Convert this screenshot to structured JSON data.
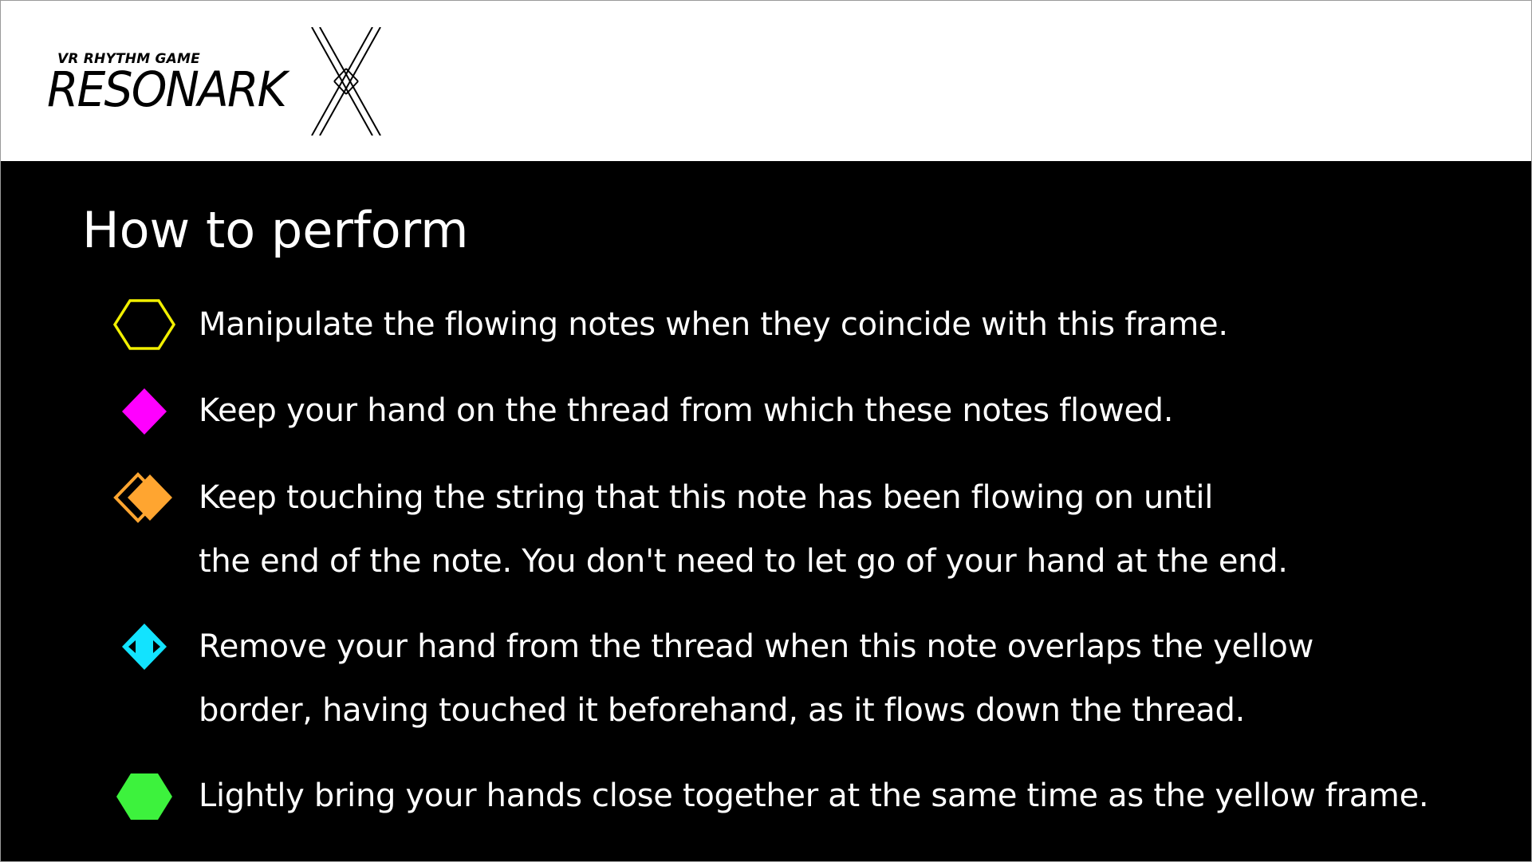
{
  "brand": {
    "subtitle": "VR RHYTHM GAME",
    "name": "RESONARK",
    "mark_icon": "crossed-lines-x-icon"
  },
  "page": {
    "title": "How to perform"
  },
  "rules": [
    {
      "icon": "yellow-hexagon-outline-icon",
      "color": "#f2f000",
      "lines": [
        "Manipulate the flowing notes when they coincide with this frame."
      ]
    },
    {
      "icon": "magenta-diamond-icon",
      "color": "#ff00ff",
      "lines": [
        "Keep your hand on the thread from which these notes flowed."
      ]
    },
    {
      "icon": "orange-double-diamond-icon",
      "color": "#ffa530",
      "lines": [
        "Keep touching the string that this note has been flowing on until",
        "the end of the note. You don't need to let go of your hand at the end."
      ]
    },
    {
      "icon": "cyan-diamond-with-arrows-icon",
      "color": "#12e3ff",
      "lines": [
        "Remove your hand from the thread when this note overlaps the yellow",
        "border, having touched it beforehand, as it flows down the thread."
      ]
    },
    {
      "icon": "green-hexagon-filled-icon",
      "color": "#3df23d",
      "lines": [
        "Lightly bring your hands close together at the same time as the yellow frame."
      ]
    }
  ],
  "colors": {
    "header_background": "#ffffff",
    "content_background": "#000000",
    "text": "#ffffff",
    "logo": "#000000"
  }
}
